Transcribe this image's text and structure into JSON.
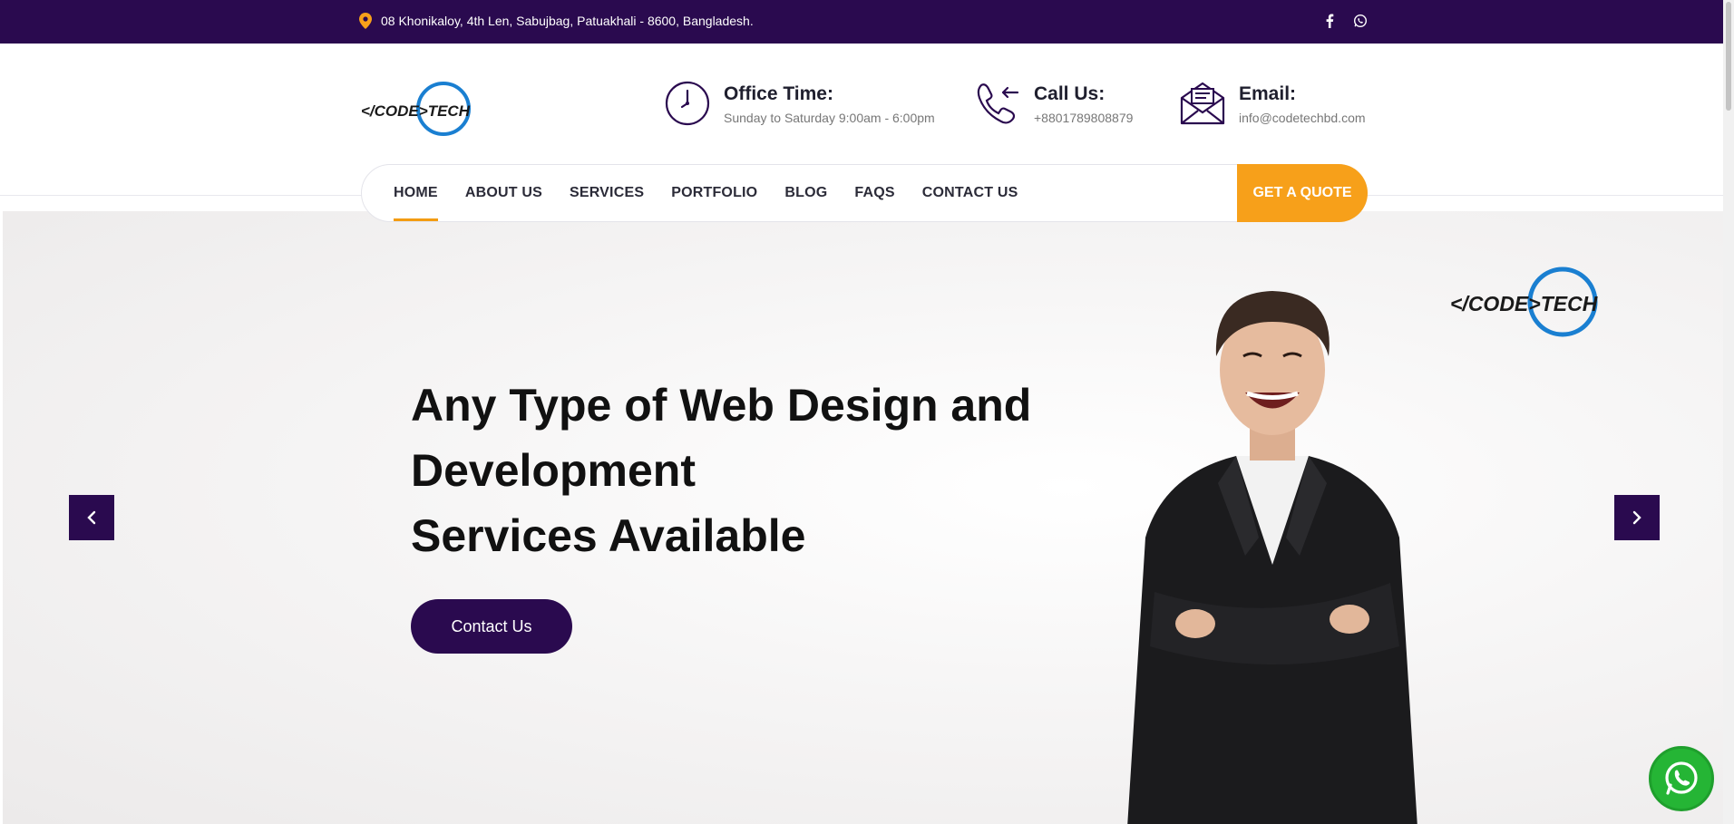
{
  "topbar": {
    "address": "08 Khonikaloy, 4th Len, Sabujbag, Patuakhali - 8600, Bangladesh.",
    "social_icons": [
      "facebook-icon",
      "whatsapp-icon"
    ]
  },
  "brand": {
    "logo_left": "</CODE>TECH",
    "colors": {
      "primary": "#2a0a4f",
      "accent": "#f7a01a",
      "logo_blue": "#1a7fd1"
    }
  },
  "header": {
    "office": {
      "title": "Office Time:",
      "value": "Sunday to Saturday 9:00am - 6:00pm"
    },
    "call": {
      "title": "Call Us:",
      "value": "+8801789808879"
    },
    "email": {
      "title": "Email:",
      "value": "info@codetechbd.com"
    }
  },
  "nav": {
    "items": [
      {
        "label": "HOME",
        "active": true
      },
      {
        "label": "ABOUT US",
        "active": false
      },
      {
        "label": "SERVICES",
        "active": false
      },
      {
        "label": "PORTFOLIO",
        "active": false
      },
      {
        "label": "BLOG",
        "active": false
      },
      {
        "label": "FAQS",
        "active": false
      },
      {
        "label": "CONTACT US",
        "active": false
      }
    ],
    "quote_button": "GET A QUOTE"
  },
  "hero": {
    "headline_line1": "Any Type of Web Design and Development",
    "headline_line2": "Services Available",
    "cta_label": "Contact Us",
    "prev_icon": "chevron-left-icon",
    "next_icon": "chevron-right-icon"
  },
  "floating": {
    "whatsapp_icon": "whatsapp-icon"
  }
}
